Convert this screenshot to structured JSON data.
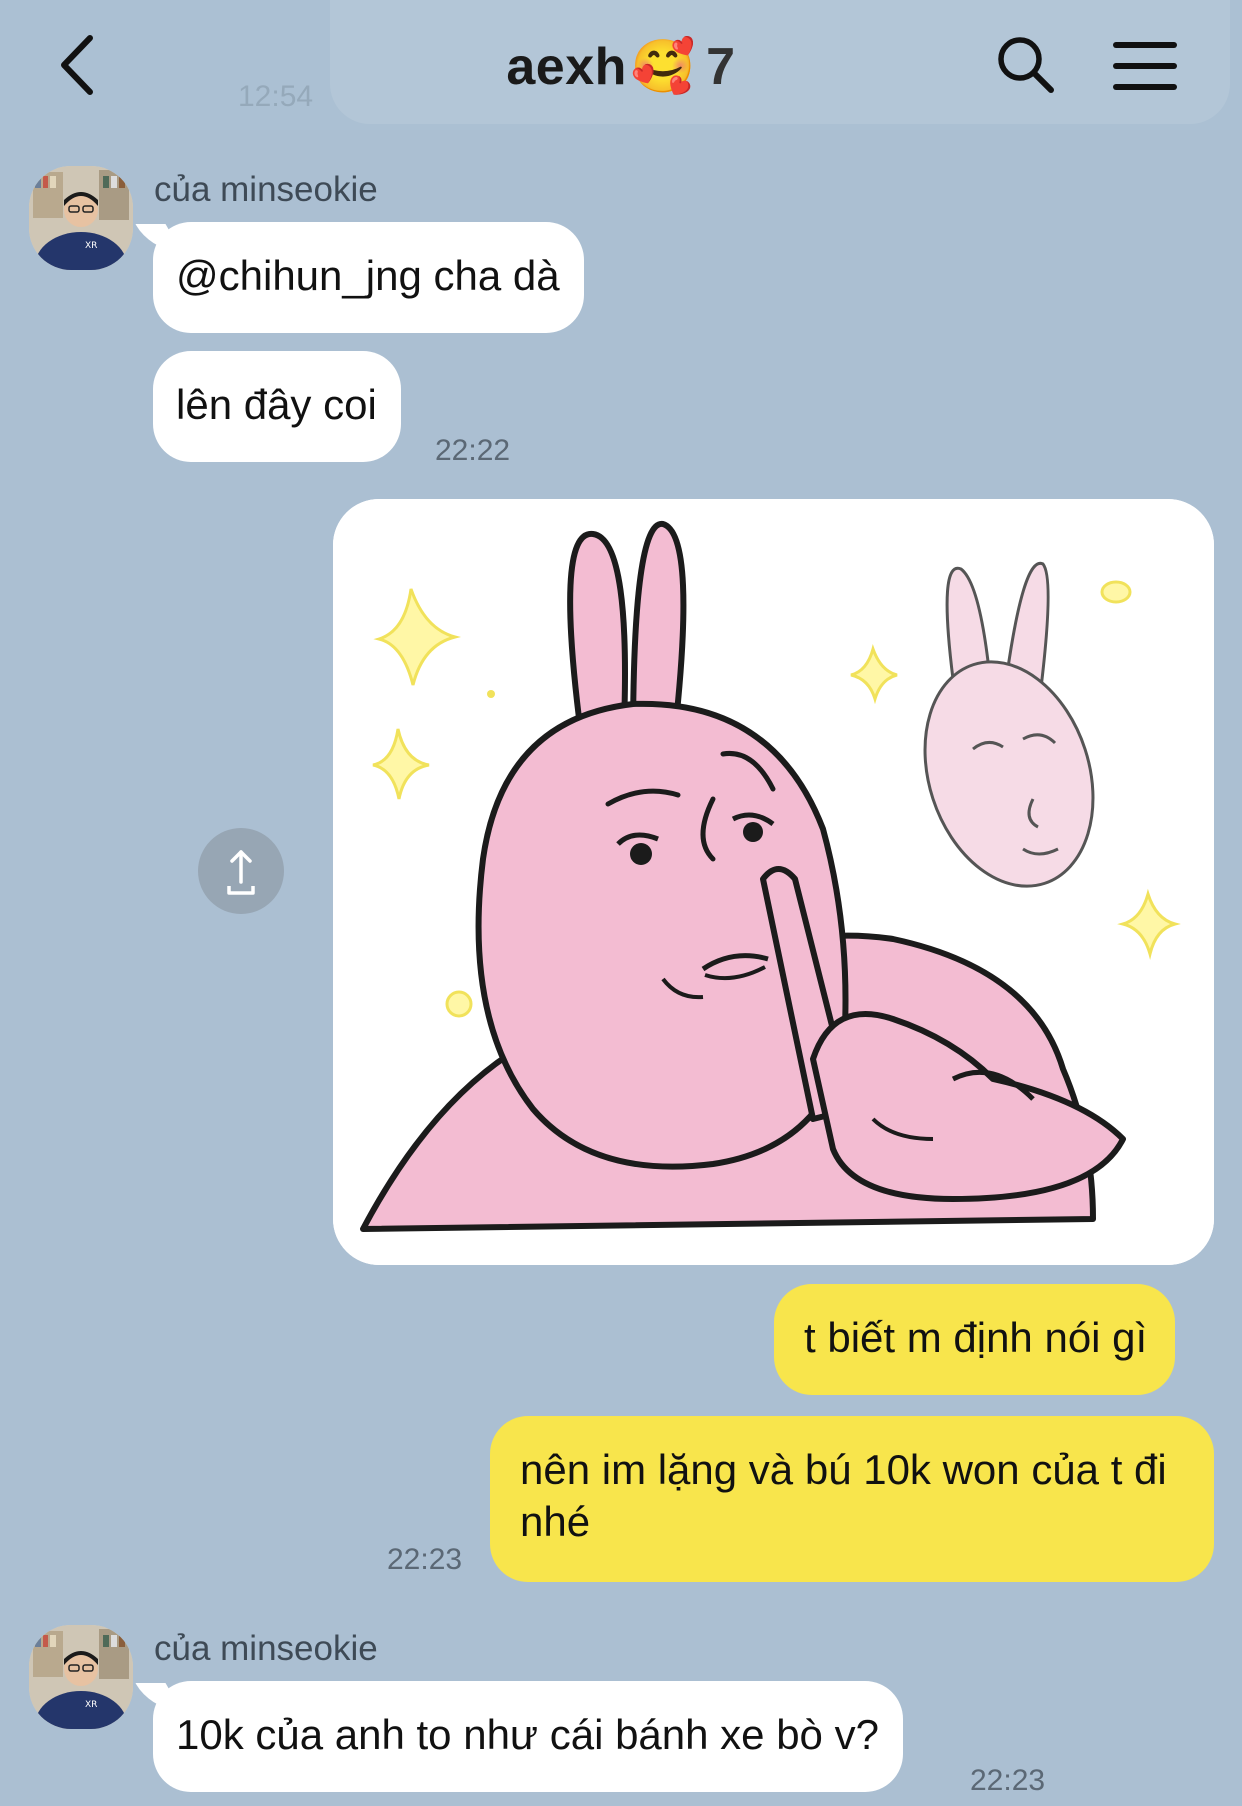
{
  "header": {
    "title": "aexh",
    "emoji": "🥰",
    "member_count": "7",
    "ghost_time": "12:54",
    "back_icon": "chevron-left-icon",
    "search_icon": "search-icon",
    "menu_icon": "hamburger-menu-icon"
  },
  "messages": [
    {
      "sender": "của minseokie",
      "texts": [
        "@chihun_jng cha dà",
        "lên đây coi"
      ],
      "time": "22:22"
    },
    {
      "sticker": "pink-rabbit-shush-sticker",
      "share_icon": "share-icon"
    },
    {
      "mine": true,
      "texts": [
        "t biết m định nói gì",
        "nên im lặng và bú 10k won của t đi nhé"
      ],
      "time": "22:23"
    },
    {
      "sender": "của minseokie",
      "texts": [
        "10k của anh to như cái bánh xe bò v?"
      ],
      "time": "22:23"
    }
  ],
  "colors": {
    "background": "#abbfd2",
    "incoming_bubble": "#ffffff",
    "outgoing_bubble": "#f8e54c",
    "sticker_pink": "#f3bcd2"
  }
}
